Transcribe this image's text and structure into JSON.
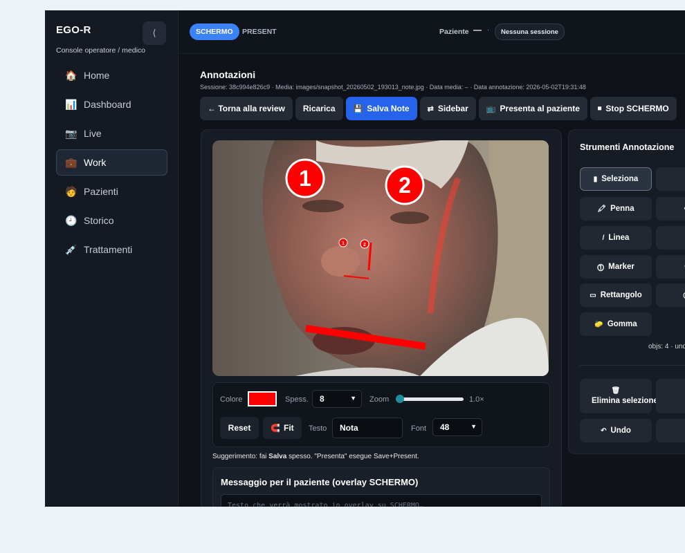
{
  "app": {
    "brand": "EGO-R",
    "subtitle": "Console operatore / medico",
    "collapse_glyph": "⟨"
  },
  "nav": [
    {
      "icon": "🏠",
      "label": "Home",
      "icon_name": "home-icon"
    },
    {
      "icon": "📊",
      "label": "Dashboard",
      "icon_name": "chart-icon"
    },
    {
      "icon": "📷",
      "label": "Live",
      "icon_name": "camera-icon"
    },
    {
      "icon": "💼",
      "label": "Work",
      "icon_name": "briefcase-icon",
      "active": true
    },
    {
      "icon": "🧑",
      "label": "Pazienti",
      "icon_name": "person-icon"
    },
    {
      "icon": "🕘",
      "label": "Storico",
      "icon_name": "clock-icon"
    },
    {
      "icon": "💉",
      "label": "Trattamenti",
      "icon_name": "syringe-icon"
    }
  ],
  "topbar": {
    "mode_active": "SCHERMO",
    "mode_other": "PRESENT",
    "patient_label": "Paziente",
    "patient_value": "—",
    "dot": "·",
    "session": "Nessuna sessione"
  },
  "header": {
    "title": "Annotazioni",
    "meta": "Sessione: 38c994e826c9 · Media: images/snapshot_20260502_193013_note.jpg · Data media: – · Data annotazione: 2026-05-02T19:31:48"
  },
  "toolbar": {
    "back": "← Torna alla review",
    "reload": "Ricarica",
    "save_icon": "💾",
    "save": "Salva Note",
    "sidebar_icon": "⇄",
    "sidebar": "Sidebar",
    "present_icon": "📺",
    "present": "Presenta al paziente",
    "stop_icon": "⏹",
    "stop": "Stop SCHERMO"
  },
  "canvas": {
    "markers": [
      "1",
      "2"
    ],
    "small_markers": [
      "1",
      "2"
    ],
    "stroke_color": "#ff0000"
  },
  "controls": {
    "color_label": "Colore",
    "color_value": "#ff0000",
    "thickness_label": "Spess.",
    "thickness_value": "8",
    "zoom_label": "Zoom",
    "zoom_value": "1.0×",
    "zoom_level": 0.05,
    "reset": "Reset",
    "fit_icon": "🧲",
    "fit": "Fit",
    "text_label": "Testo",
    "text_value": "Nota",
    "font_label": "Font",
    "font_value": "48"
  },
  "hint": {
    "prefix": "Suggerimento: fai ",
    "bold": "Salva",
    "suffix": " spesso. \"Presenta\" esegue Save+Present."
  },
  "message": {
    "title": "Messaggio per il paziente (overlay SCHERMO)",
    "placeholder": "Testo che verrà mostrato in overlay su SCHERMO…"
  },
  "tools": {
    "title": "Strumenti Annotazione",
    "select_icon": "▮",
    "select": "Seleziona",
    "hand_icon": "✋",
    "pen_icon": "🖍",
    "pen": "Penna",
    "e_icon": "✏",
    "e_partial": "E",
    "line_icon": "/",
    "line": "Linea",
    "t_icon": "T",
    "t_partial": "T",
    "marker_icon": "⓵",
    "marker": "Marker",
    "bubble_icon": "💬",
    "bubble_partial": "(",
    "rect_icon": "▭",
    "rect": "Rettangolo",
    "circle_icon": "◯",
    "circle_partial": "C",
    "eraser_icon": "🧽",
    "eraser": "Gomma",
    "objs": "objs: 4 · undo",
    "delete_icon": "🗑",
    "delete": "Elimina selezione",
    "brush_icon": "🧹",
    "undo_icon": "↶",
    "undo": "Undo",
    "redo_icon": "↷"
  }
}
